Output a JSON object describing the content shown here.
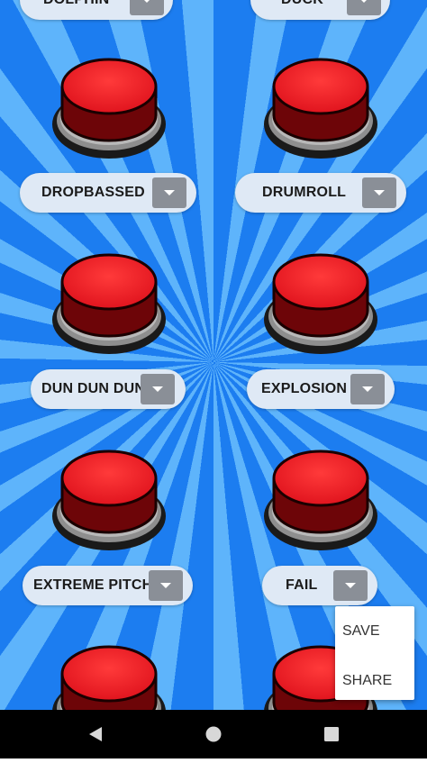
{
  "sounds": [
    {
      "label": "DOLPHIN"
    },
    {
      "label": "DUCK"
    },
    {
      "label": "DROPBASSED"
    },
    {
      "label": "DRUMROLL"
    },
    {
      "label": "DUN DUN DUN"
    },
    {
      "label": "EXPLOSION"
    },
    {
      "label": "EXTREME PITCH"
    },
    {
      "label": "FAIL"
    }
  ],
  "popup_menu": {
    "items": [
      {
        "label": "SAVE"
      },
      {
        "label": "SHARE"
      }
    ]
  },
  "navbar": {
    "back_icon": "back-triangle-icon",
    "home_icon": "home-circle-icon",
    "recents_icon": "recents-square-icon"
  },
  "colors": {
    "button_red": "#e0141e",
    "ray_dark": "#1c7df0",
    "ray_light": "#5eb4fb",
    "pill_bg": "#dfe9f5",
    "dropdown_bg": "#8a8f97"
  }
}
